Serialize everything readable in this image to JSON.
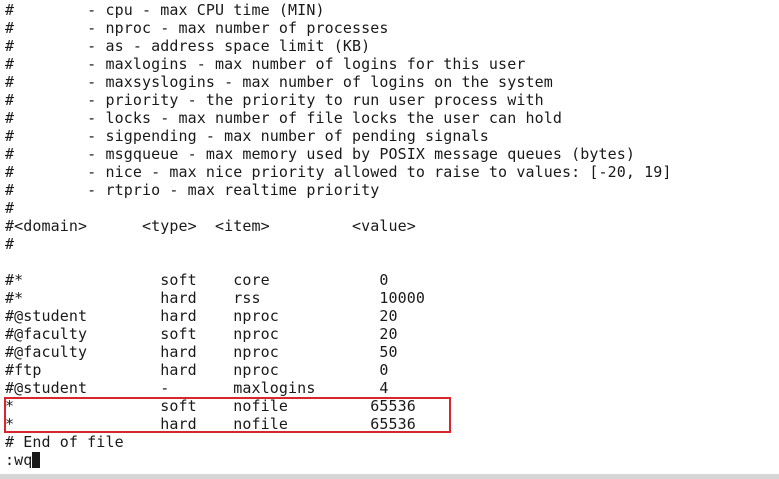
{
  "terminal": {
    "lines": [
      "#        - cpu - max CPU time (MIN)",
      "#        - nproc - max number of processes",
      "#        - as - address space limit (KB)",
      "#        - maxlogins - max number of logins for this user",
      "#        - maxsyslogins - max number of logins on the system",
      "#        - priority - the priority to run user process with",
      "#        - locks - max number of file locks the user can hold",
      "#        - sigpending - max number of pending signals",
      "#        - msgqueue - max memory used by POSIX message queues (bytes)",
      "#        - nice - max nice priority allowed to raise to values: [-20, 19]",
      "#        - rtprio - max realtime priority",
      "#",
      "#<domain>      <type>  <item>         <value>",
      "#",
      "",
      "#*               soft    core            0",
      "#*               hard    rss             10000",
      "#@student        hard    nproc           20",
      "#@faculty        soft    nproc           20",
      "#@faculty        hard    nproc           50",
      "#ftp             hard    nproc           0",
      "#@student        -       maxlogins       4",
      "*                soft    nofile         65536",
      "*                hard    nofile         65536",
      "# End of file"
    ],
    "command": ":wq"
  },
  "colors": {
    "highlight": "#d9262c",
    "text": "#1a1a1a",
    "background": "#ffffff"
  }
}
